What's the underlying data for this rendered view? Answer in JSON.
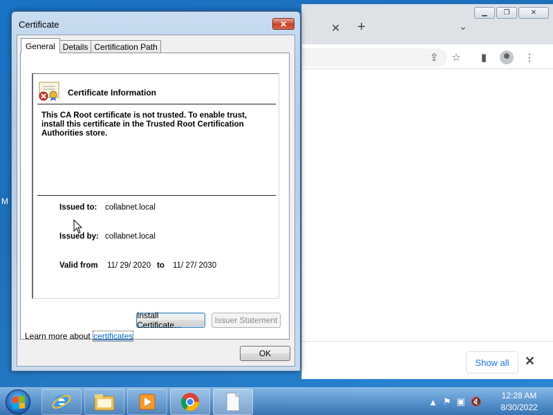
{
  "browser": {
    "downloads": {
      "show_all_label": "Show all"
    },
    "left_edge_text": "M"
  },
  "dialog": {
    "title": "Certificate",
    "tabs": [
      {
        "label": "General"
      },
      {
        "label": "Details"
      },
      {
        "label": "Certification Path"
      }
    ],
    "info": {
      "heading": "Certificate Information",
      "message": "This CA Root certificate is not trusted. To enable trust, install this certificate in the Trusted Root Certification Authorities store.",
      "issued_to_label": "Issued to:",
      "issued_to_value": "collabnet.local",
      "issued_by_label": "Issued by:",
      "issued_by_value": "collabnet.local",
      "valid_from_label": "Valid from",
      "valid_from_value": "11/ 29/ 2020",
      "to_label": "to",
      "valid_to_value": "11/ 27/ 2030"
    },
    "install_button": "Install Certificate...",
    "issuer_statement_button": "Issuer Statement",
    "learn_more_text": "Learn more about ",
    "learn_more_link": "certificates",
    "ok_button": "OK"
  },
  "taskbar": {
    "time": "12:28 AM",
    "date": "8/30/2022"
  }
}
